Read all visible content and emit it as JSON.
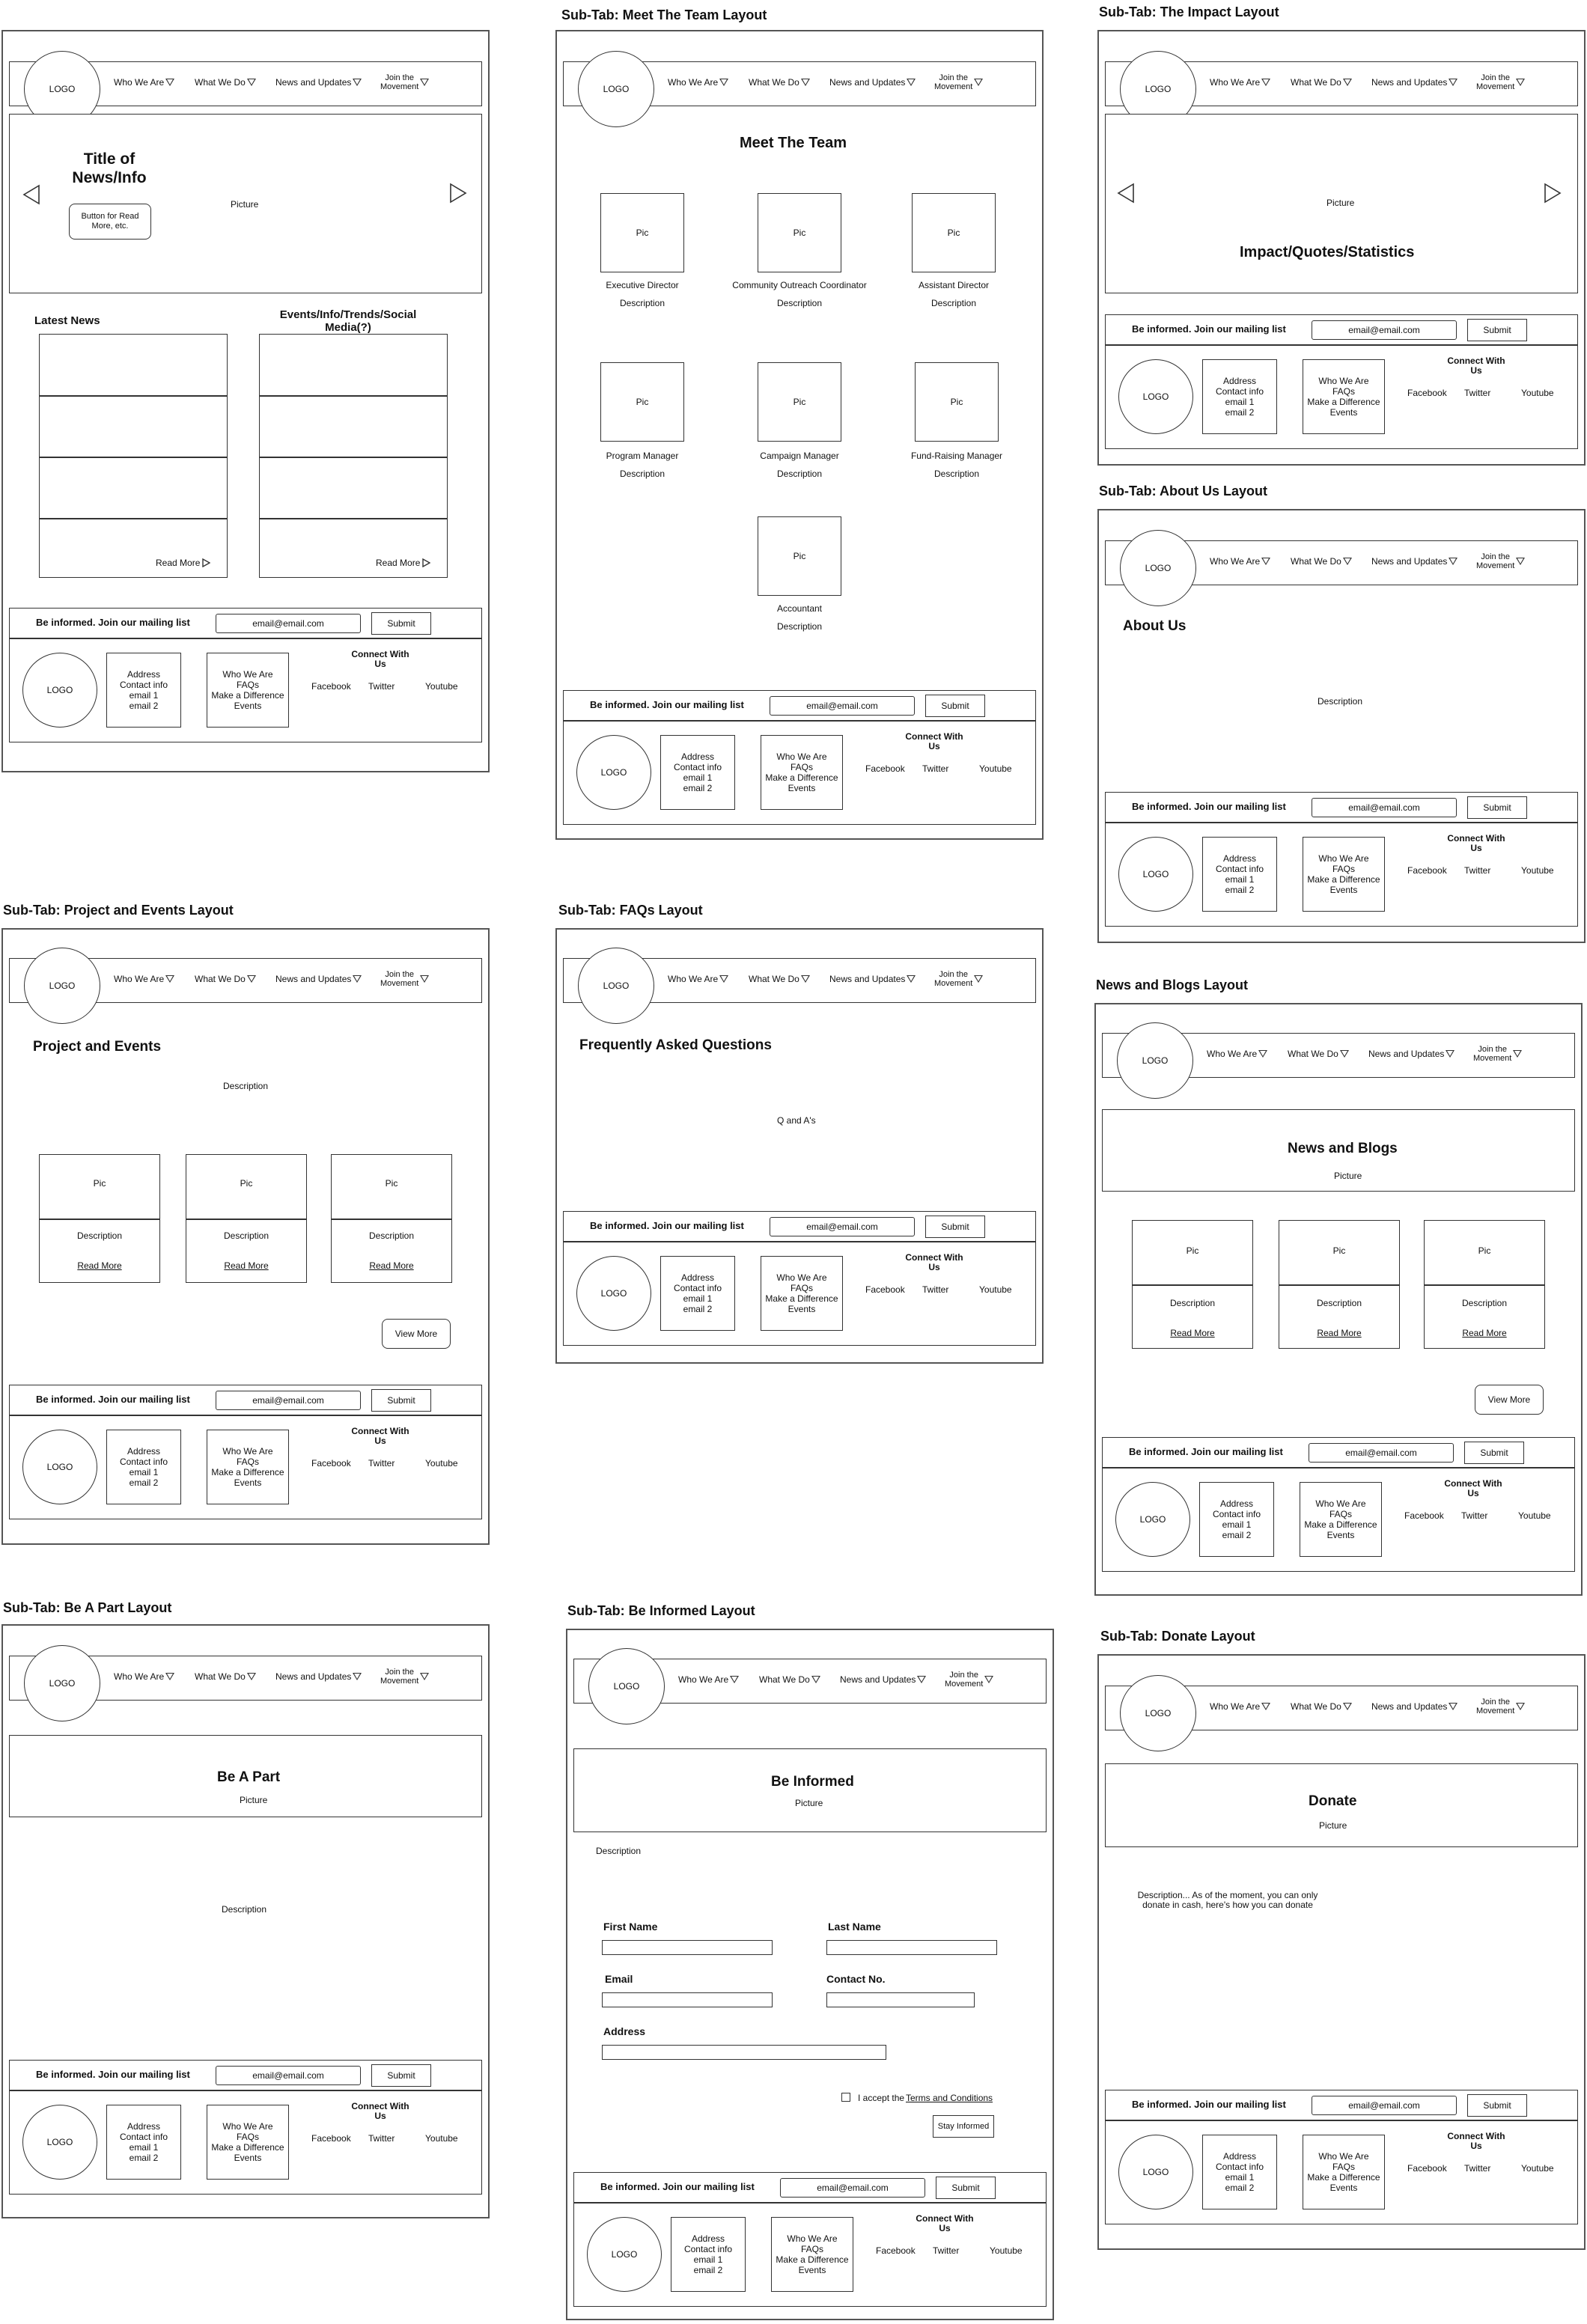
{
  "nav": {
    "logo": "LOGO",
    "who": "Who We Are",
    "what": "What We Do",
    "news": "News and Updates",
    "join": "Join the\nMovement"
  },
  "footer": {
    "mailing": "Be informed. Join our mailing list",
    "email_placeholder": "email@email.com",
    "submit": "Submit",
    "logo": "LOGO",
    "contact": "Address\nContact info\nemail 1\nemail 2",
    "links": "Who We Are\nFAQs\nMake a Difference\nEvents",
    "connect": "Connect With\nUs",
    "facebook": "Facebook",
    "twitter": "Twitter",
    "youtube": "Youtube"
  },
  "home": {
    "hero_title": "Title of\nNews/Info",
    "hero_button": "Button for Read\nMore, etc.",
    "hero_picture": "Picture",
    "latest_news": "Latest News",
    "events_heading": "Events/Info/Trends/Social\nMedia(?)",
    "read_more": "Read More"
  },
  "team": {
    "title": "Sub-Tab: Meet The Team Layout",
    "heading": "Meet The Team",
    "pic": "Pic",
    "description": "Description",
    "members": [
      "Executive Director",
      "Community Outreach Coordinator",
      "Assistant Director",
      "Program Manager",
      "Campaign Manager",
      "Fund-Raising Manager",
      "Accountant"
    ]
  },
  "impact": {
    "title": "Sub-Tab: The Impact Layout",
    "picture": "Picture",
    "heading": "Impact/Quotes/Statistics"
  },
  "about": {
    "title": "Sub-Tab: About Us Layout",
    "heading": "About Us",
    "description": "Description"
  },
  "projects": {
    "title": "Sub-Tab: Project and Events Layout",
    "heading": "Project and Events",
    "description": "Description",
    "pic": "Pic",
    "card_description": "Description",
    "read_more": "Read More",
    "view_more": "View More"
  },
  "faqs": {
    "title": "Sub-Tab: FAQs Layout",
    "heading": "Frequently Asked Questions",
    "qa": "Q and A's"
  },
  "news": {
    "title": "News and Blogs Layout",
    "heading": "News and Blogs",
    "picture": "Picture",
    "pic": "Pic",
    "card_description": "Description",
    "read_more": "Read More",
    "view_more": "View More"
  },
  "bepart": {
    "title": "Sub-Tab: Be A Part Layout",
    "heading": "Be A Part",
    "picture": "Picture",
    "description": "Description"
  },
  "informed": {
    "title": "Sub-Tab: Be Informed Layout",
    "heading": "Be Informed",
    "picture": "Picture",
    "description": "Description",
    "first_name": "First Name",
    "last_name": "Last Name",
    "email": "Email",
    "contact_no": "Contact No.",
    "address": "Address",
    "accept": "I accept the",
    "terms": "Terms and Conditions",
    "stay": "Stay Informed"
  },
  "donate": {
    "title": "Sub-Tab: Donate Layout",
    "heading": "Donate",
    "picture": "Picture",
    "description": "Description... As of the moment, you can only\ndonate in cash, here's how you can donate"
  }
}
